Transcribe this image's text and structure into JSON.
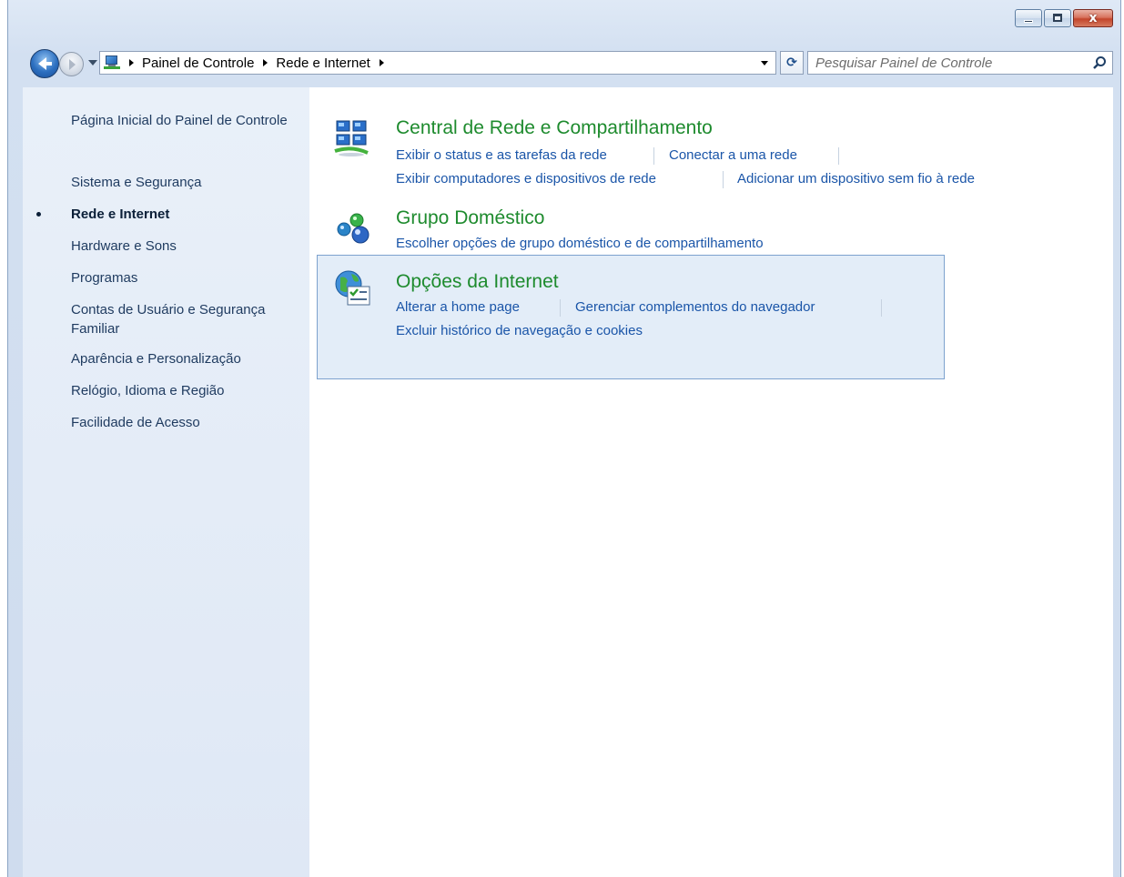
{
  "window": {
    "controls": {
      "close_glyph": "x"
    }
  },
  "nav": {
    "breadcrumbs": [
      "Painel de Controle",
      "Rede e Internet"
    ],
    "search_placeholder": "Pesquisar Painel de Controle",
    "refresh_glyph": "⟳"
  },
  "sidebar": {
    "items": [
      {
        "label": "Página Inicial do Painel de Controle",
        "active": false
      },
      {
        "label": "Sistema e Segurança",
        "active": false
      },
      {
        "label": "Rede e Internet",
        "active": true
      },
      {
        "label": "Hardware e Sons",
        "active": false
      },
      {
        "label": "Programas",
        "active": false
      },
      {
        "label": "Contas de Usuário e Segurança Familiar",
        "active": false
      },
      {
        "label": "Aparência e Personalização",
        "active": false
      },
      {
        "label": "Relógio, Idioma e Região",
        "active": false
      },
      {
        "label": "Facilidade de Acesso",
        "active": false
      }
    ]
  },
  "categories": [
    {
      "title": "Central de Rede e Compartilhamento",
      "icon": "network-center-icon",
      "links": [
        "Exibir o status e as tarefas da rede",
        "Conectar a uma rede",
        "Exibir computadores e dispositivos de rede",
        "Adicionar um dispositivo sem fio à rede"
      ]
    },
    {
      "title": "Grupo Doméstico",
      "icon": "homegroup-icon",
      "links": [
        "Escolher opções de grupo doméstico e de compartilhamento"
      ]
    },
    {
      "title": "Opções da Internet",
      "icon": "internet-options-icon",
      "highlighted": true,
      "links": [
        "Alterar a home page",
        "Gerenciar complementos do navegador",
        "Excluir histórico de navegação e cookies"
      ]
    }
  ],
  "colors": {
    "title_green": "#1e8b2e",
    "link_blue": "#1a55a8",
    "hover_bg": "#e3edf8"
  }
}
